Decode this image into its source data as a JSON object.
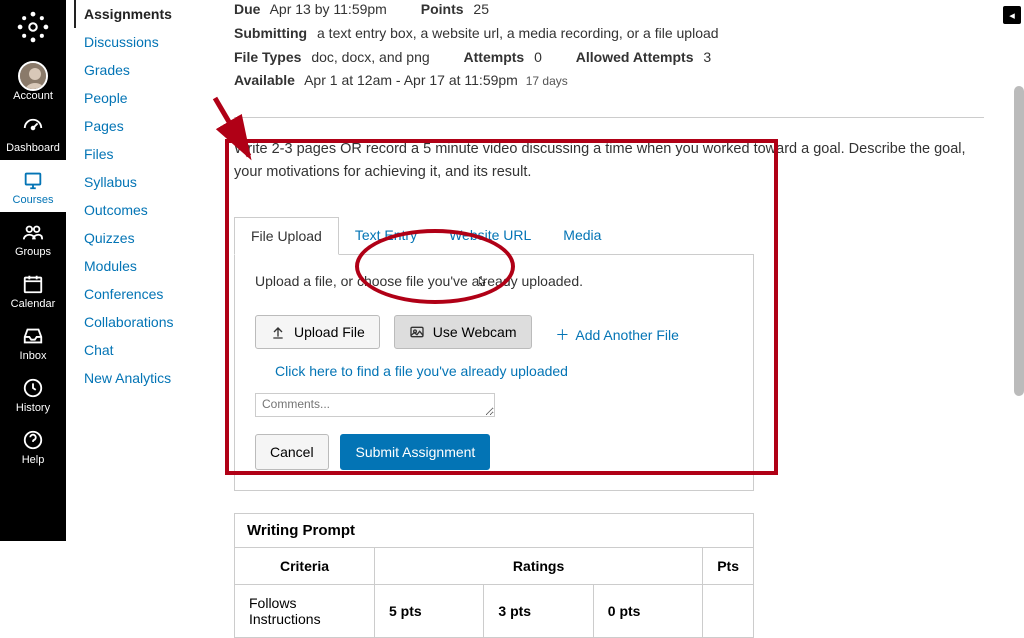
{
  "global_nav": [
    {
      "label": "Account"
    },
    {
      "label": "Dashboard"
    },
    {
      "label": "Courses"
    },
    {
      "label": "Groups"
    },
    {
      "label": "Calendar"
    },
    {
      "label": "Inbox"
    },
    {
      "label": "History"
    },
    {
      "label": "Help"
    }
  ],
  "course_nav": [
    "Assignments",
    "Discussions",
    "Grades",
    "People",
    "Pages",
    "Files",
    "Syllabus",
    "Outcomes",
    "Quizzes",
    "Modules",
    "Conferences",
    "Collaborations",
    "Chat",
    "New Analytics"
  ],
  "details": {
    "due_label": "Due",
    "due_value": "Apr 13 by 11:59pm",
    "points_label": "Points",
    "points_value": "25",
    "submitting_label": "Submitting",
    "submitting_value": "a text entry box, a website url, a media recording, or a file upload",
    "filetypes_label": "File Types",
    "filetypes_value": "doc, docx, and png",
    "attempts_label": "Attempts",
    "attempts_value": "0",
    "allowed_label": "Allowed Attempts",
    "allowed_value": "3",
    "available_label": "Available",
    "available_value": "Apr 1 at 12am - Apr 17 at 11:59pm",
    "available_days": "17 days"
  },
  "instructions": "Write 2-3 pages OR record a 5 minute video discussing a time when you worked toward a goal. Describe the goal, your motivations for achieving it, and its result.",
  "tabs": {
    "a": "File Upload",
    "b": "Text Entry",
    "c": "Website URL",
    "d": "Media"
  },
  "upload": {
    "hint": "Upload a file, or choose file you've already uploaded.",
    "btn_upload": "Upload File",
    "btn_webcam": "Use Webcam",
    "add_another": "Add Another File",
    "already": "Click here to find a file you've already uploaded",
    "comments_placeholder": "Comments...",
    "cancel": "Cancel",
    "submit": "Submit Assignment"
  },
  "rubric": {
    "title": "Writing Prompt",
    "h_criteria": "Criteria",
    "h_ratings": "Ratings",
    "h_pts": "Pts",
    "row1_criteria": "Follows Instructions",
    "row1_r1": "5 pts",
    "row1_r2": "3 pts",
    "row1_r3": "0 pts"
  }
}
